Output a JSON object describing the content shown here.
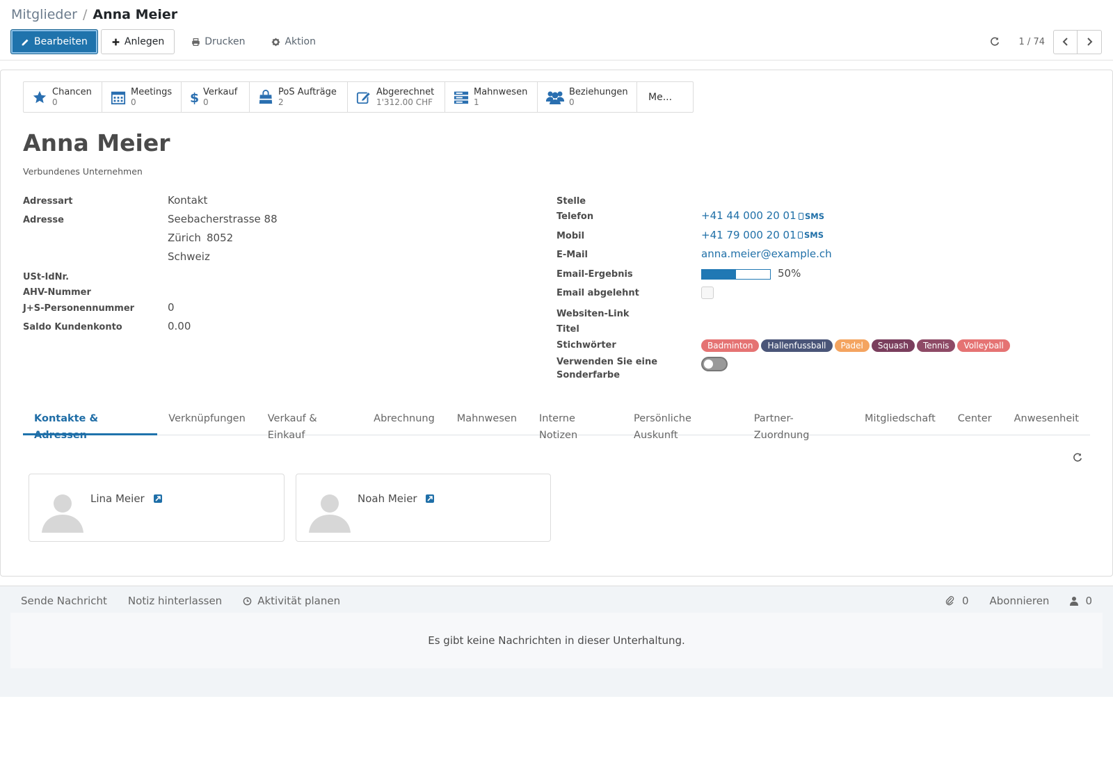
{
  "breadcrumb": {
    "parent": "Mitglieder",
    "separator": "/",
    "current": "Anna Meier"
  },
  "toolbar": {
    "edit": "Bearbeiten",
    "create": "Anlegen",
    "print": "Drucken",
    "action": "Aktion"
  },
  "pager": {
    "value": "1 / 74"
  },
  "smart_buttons": [
    {
      "label": "Chancen",
      "value": "0",
      "icon": "star-icon"
    },
    {
      "label": "Meetings",
      "value": "0",
      "icon": "calendar-icon"
    },
    {
      "label": "Verkauf",
      "value": "0",
      "icon": "dollar-icon"
    },
    {
      "label": "PoS Aufträge",
      "value": "2",
      "icon": "shopping-bag-icon"
    },
    {
      "label": "Abgerechnet",
      "value": "1'312.00 CHF",
      "icon": "pencil-square-icon"
    },
    {
      "label": "Mahnwesen",
      "value": "1",
      "icon": "list-icon"
    },
    {
      "label": "Beziehungen",
      "value": "0",
      "icon": "users-icon"
    }
  ],
  "more_button": "Me...",
  "record": {
    "name": "Anna Meier",
    "subtitle": "Verbundenes Unternehmen"
  },
  "left_fields": {
    "adressart_label": "Adressart",
    "adressart_value": "Kontakt",
    "adresse_label": "Adresse",
    "street": "Seebacherstrasse 88",
    "city": "Zürich",
    "zip": "8052",
    "country": "Schweiz",
    "ust_label": "USt-IdNr.",
    "ahv_label": "AHV-Nummer",
    "js_label": "J+S-Personennummer",
    "js_value": "0",
    "saldo_label": "Saldo Kundenkonto",
    "saldo_value": "0.00"
  },
  "right_fields": {
    "stelle_label": "Stelle",
    "telefon_label": "Telefon",
    "telefon_value": "+41 44 000 20 01",
    "mobil_label": "Mobil",
    "mobil_value": "+41 79 000 20 01",
    "sms_label": "SMS",
    "email_label": "E-Mail",
    "email_value": "anna.meier@example.ch",
    "email_result_label": "Email-Ergebnis",
    "email_result_value": "50%",
    "email_result_fraction": 0.5,
    "email_declined_label": "Email abgelehnt",
    "website_label": "Websiten-Link",
    "titel_label": "Titel",
    "tags_label": "Stichwörter",
    "color_label_1": "Verwenden Sie eine",
    "color_label_2": "Sonderfarbe"
  },
  "tags": [
    {
      "label": "Badminton",
      "color": "#e57373"
    },
    {
      "label": "Hallenfussball",
      "color": "#4a5578"
    },
    {
      "label": "Padel",
      "color": "#f4a460"
    },
    {
      "label": "Squash",
      "color": "#7a3e5d"
    },
    {
      "label": "Tennis",
      "color": "#8e4a66"
    },
    {
      "label": "Volleyball",
      "color": "#e57373"
    }
  ],
  "tabs": [
    "Kontakte & Adressen",
    "Verknüpfungen",
    "Verkauf & Einkauf",
    "Abrechnung",
    "Mahnwesen",
    "Interne Notizen",
    "Persönliche Auskunft",
    "Partner-Zuordnung",
    "Mitgliedschaft",
    "Center",
    "Anwesenheit"
  ],
  "contacts": [
    {
      "name": "Lina Meier"
    },
    {
      "name": "Noah Meier"
    }
  ],
  "chatter": {
    "send_message": "Sende Nachricht",
    "log_note": "Notiz hinterlassen",
    "schedule_activity": "Aktivität planen",
    "attachments_count": "0",
    "follow": "Abonnieren",
    "followers_count": "0",
    "empty_text": "Es gibt keine Nachrichten in dieser Unterhaltung."
  },
  "colors": {
    "primary": "#1f73ac",
    "link": "#2070a8"
  }
}
